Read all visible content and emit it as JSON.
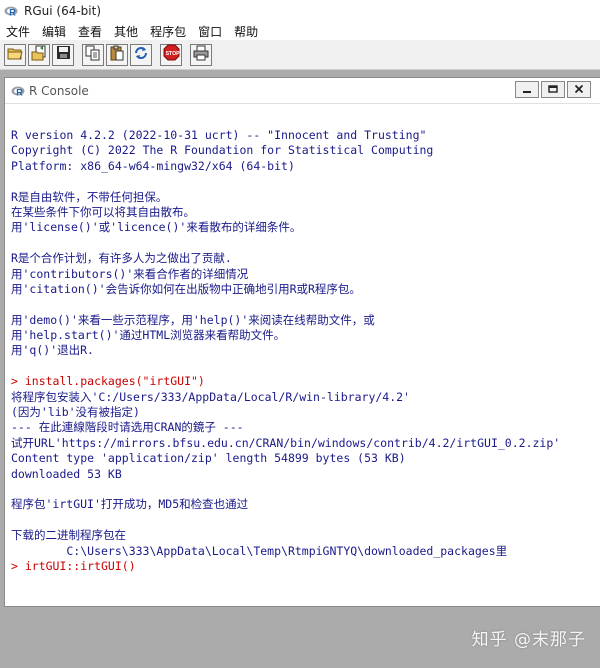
{
  "app": {
    "title": "RGui (64-bit)"
  },
  "menu": [
    "文件",
    "编辑",
    "查看",
    "其他",
    "程序包",
    "窗口",
    "帮助"
  ],
  "toolbar": {
    "icons": [
      "open-script-icon",
      "load-workspace-icon",
      "save-icon",
      "copy-icon",
      "paste-icon",
      "copy-paste-icon",
      "stop-icon",
      "print-icon"
    ]
  },
  "console": {
    "title": "R Console",
    "lines": [
      {
        "text": "R version 4.2.2 (2022-10-31 ucrt) -- \"Innocent and Trusting\"",
        "type": "output"
      },
      {
        "text": "Copyright (C) 2022 The R Foundation for Statistical Computing",
        "type": "output"
      },
      {
        "text": "Platform: x86_64-w64-mingw32/x64 (64-bit)",
        "type": "output"
      },
      {
        "text": "",
        "type": "blank"
      },
      {
        "text": "R是自由软件，不带任何担保。",
        "type": "output"
      },
      {
        "text": "在某些条件下你可以将其自由散布。",
        "type": "output"
      },
      {
        "text": "用'license()'或'licence()'来看散布的详细条件。",
        "type": "output"
      },
      {
        "text": "",
        "type": "blank"
      },
      {
        "text": "R是个合作计划，有许多人为之做出了贡献.",
        "type": "output"
      },
      {
        "text": "用'contributors()'来看合作者的详细情况",
        "type": "output"
      },
      {
        "text": "用'citation()'会告诉你如何在出版物中正确地引用R或R程序包。",
        "type": "output"
      },
      {
        "text": "",
        "type": "blank"
      },
      {
        "text": "用'demo()'来看一些示范程序，用'help()'来阅读在线帮助文件，或",
        "type": "output"
      },
      {
        "text": "用'help.start()'通过HTML浏览器来看帮助文件。",
        "type": "output"
      },
      {
        "text": "用'q()'退出R.",
        "type": "output"
      },
      {
        "text": "",
        "type": "blank"
      },
      {
        "text": "> install.packages(\"irtGUI\")",
        "type": "input"
      },
      {
        "text": "将程序包安装入'C:/Users/333/AppData/Local/R/win-library/4.2'",
        "type": "output"
      },
      {
        "text": "(因为'lib'没有被指定)",
        "type": "output"
      },
      {
        "text": "--- 在此連線階段时请选用CRAN的鏡子 ---",
        "type": "output"
      },
      {
        "text": "试开URL'https://mirrors.bfsu.edu.cn/CRAN/bin/windows/contrib/4.2/irtGUI_0.2.zip'",
        "type": "output"
      },
      {
        "text": "Content type 'application/zip' length 54899 bytes (53 KB)",
        "type": "output"
      },
      {
        "text": "downloaded 53 KB",
        "type": "output"
      },
      {
        "text": "",
        "type": "blank"
      },
      {
        "text": "程序包'irtGUI'打开成功，MD5和检查也通过",
        "type": "output"
      },
      {
        "text": "",
        "type": "blank"
      },
      {
        "text": "下载的二进制程序包在",
        "type": "output"
      },
      {
        "text": "        C:\\Users\\333\\AppData\\Local\\Temp\\RtmpiGNTYQ\\downloaded_packages里",
        "type": "output"
      },
      {
        "text": "> irtGUI::irtGUI()",
        "type": "input"
      }
    ]
  },
  "watermark": "知乎 @末那子",
  "colors": {
    "output_text": "#1a1a8a",
    "input_text": "#cc0000",
    "mdi_background": "#ababab"
  }
}
